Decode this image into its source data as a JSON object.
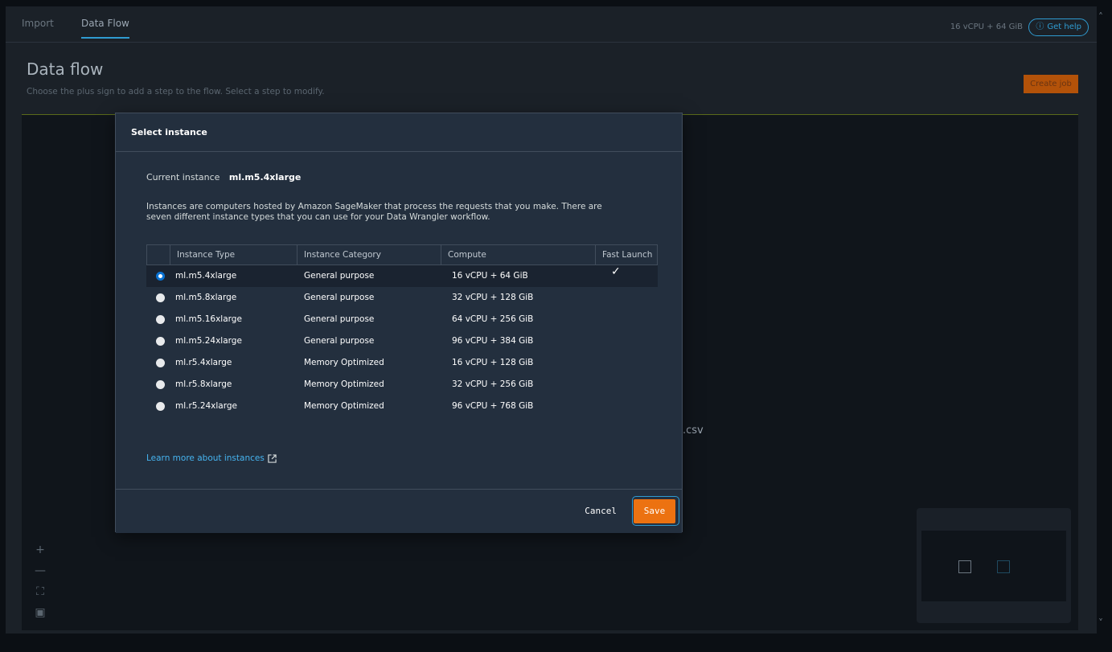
{
  "tabs": [
    {
      "label": "Import"
    },
    {
      "label": "Data Flow"
    }
  ],
  "header": {
    "resource_readout": "16 vCPU + 64 GiB",
    "help_label": "Get help"
  },
  "page": {
    "title": "Data flow",
    "subtitle": "Choose the plus sign to add a step to the flow. Select a step to modify.",
    "create_job_label": "Create job",
    "canvas_node_label": ".csv"
  },
  "canvas_controls": {
    "zoom_in": "+",
    "zoom_out": "—",
    "fit": "⛶",
    "lock": "▣"
  },
  "modal": {
    "title": "Select instance",
    "current_label": "Current instance",
    "current_value": "ml.m5.4xlarge",
    "description": "Instances are computers hosted by Amazon SageMaker that process the requests that you make. There are seven different instance types that you can use for your Data Wrangler workflow.",
    "columns": [
      "Instance Type",
      "Instance Category",
      "Compute",
      "Fast Launch"
    ],
    "rows": [
      {
        "type": "ml.m5.4xlarge",
        "category": "General purpose",
        "compute": "16 vCPU + 64 GiB",
        "fast_launch": "✓",
        "selected": true
      },
      {
        "type": "ml.m5.8xlarge",
        "category": "General purpose",
        "compute": "32 vCPU + 128 GiB",
        "fast_launch": "",
        "selected": false
      },
      {
        "type": "ml.m5.16xlarge",
        "category": "General purpose",
        "compute": "64 vCPU + 256 GiB",
        "fast_launch": "",
        "selected": false
      },
      {
        "type": "ml.m5.24xlarge",
        "category": "General purpose",
        "compute": "96 vCPU + 384 GiB",
        "fast_launch": "",
        "selected": false
      },
      {
        "type": "ml.r5.4xlarge",
        "category": "Memory Optimized",
        "compute": "16 vCPU + 128 GiB",
        "fast_launch": "",
        "selected": false
      },
      {
        "type": "ml.r5.8xlarge",
        "category": "Memory Optimized",
        "compute": "32 vCPU + 256 GiB",
        "fast_launch": "",
        "selected": false
      },
      {
        "type": "ml.r5.24xlarge",
        "category": "Memory Optimized",
        "compute": "96 vCPU + 768 GiB",
        "fast_launch": "",
        "selected": false
      }
    ],
    "learn_more": "Learn more about instances",
    "cancel_label": "Cancel",
    "save_label": "Save"
  }
}
